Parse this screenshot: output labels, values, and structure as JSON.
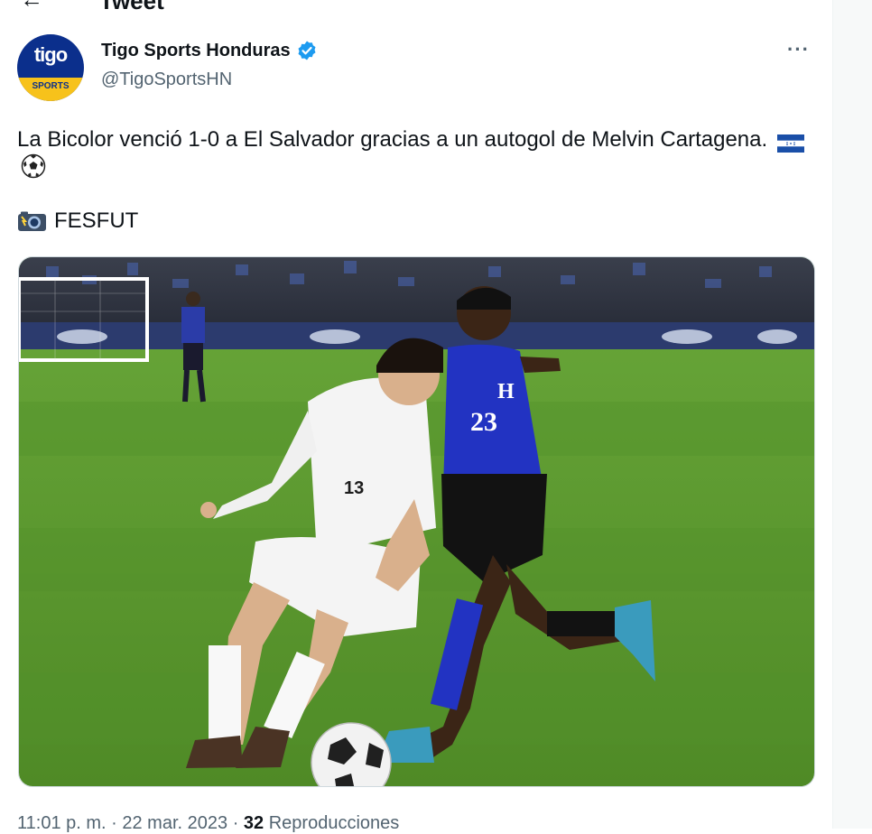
{
  "header": {
    "title": "Tweet"
  },
  "author": {
    "display_name": "Tigo Sports Honduras",
    "handle": "@TigoSportsHN",
    "avatar_logo": "tigo",
    "avatar_band": "SPORTS",
    "verified": true
  },
  "tweet": {
    "text": "La Bicolor venció 1-0 a El Salvador gracias a un autogol de Melvin Cartagena.",
    "emojis": [
      "honduras-flag",
      "soccer-ball"
    ],
    "credit": "FESFUT",
    "credit_icon": "camera-with-flash"
  },
  "media": {
    "description_icon": "soccer-photo",
    "player_white_number": "13",
    "player_blue_number": "23",
    "player_blue_letter": "H"
  },
  "meta": {
    "time": "11:01 p. m.",
    "date": "22 mar. 2023",
    "separator": "·",
    "views_count": "32",
    "views_label": "Reproducciones"
  },
  "colors": {
    "text_primary": "#0f1419",
    "text_secondary": "#536471",
    "verified_blue": "#1d9bf0",
    "pitch_green": "#5c9a2e"
  }
}
